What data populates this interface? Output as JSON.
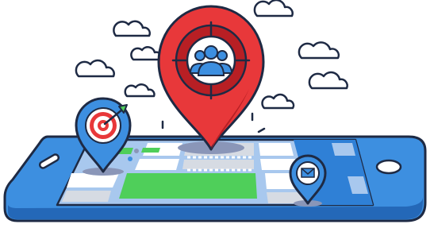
{
  "scene": {
    "kind": "location-marketing-illustration",
    "icons": [
      "audience-pin-icon",
      "target-pin-icon",
      "mail-pin-icon",
      "cloud-icon",
      "smartphone-icon",
      "map-icon"
    ]
  },
  "palette": {
    "outline": "#1e2a44",
    "phone_blue": "#3d8fe0",
    "phone_dark": "#2468b8",
    "map_green": "#4fcf5a",
    "map_blue": "#2f80d6",
    "map_light_blue": "#a8c8ee",
    "map_grey": "#d6dbe3",
    "pin_red": "#e8383a",
    "pin_red_dark": "#b81f24",
    "cloud_fill": "#ffffff",
    "shadow": "#8a96b8"
  }
}
